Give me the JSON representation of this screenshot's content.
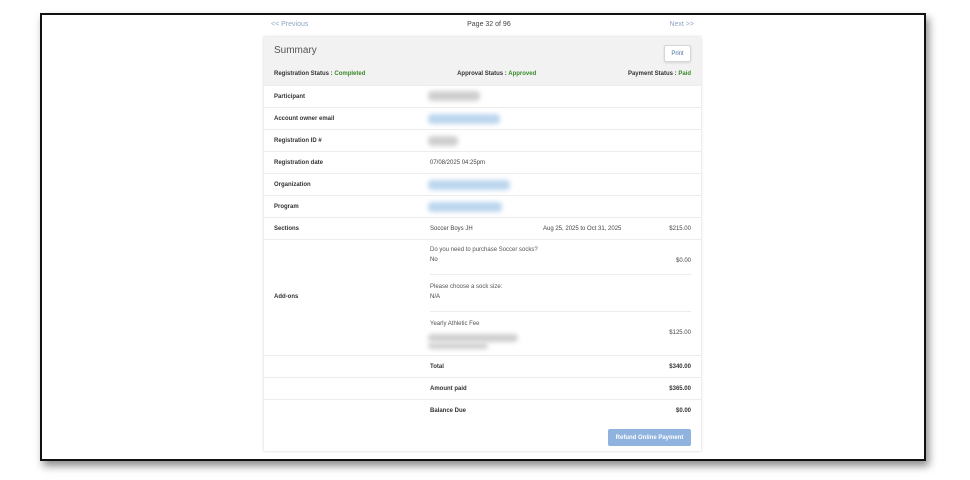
{
  "pager": {
    "previous": "<< Previous",
    "page": "Page 32 of 96",
    "next": "Next >>"
  },
  "summary": {
    "title": "Summary",
    "print": "Print",
    "registration_status_label": "Registration Status :",
    "registration_status": "Completed",
    "approval_status_label": "Approval Status :",
    "approval_status": "Approved",
    "payment_status_label": "Payment Status :",
    "payment_status": "Paid"
  },
  "rows": {
    "participant": "Participant",
    "account_email": "Account owner email",
    "registration_id": "Registration ID #",
    "registration_date": "Registration date",
    "registration_date_value": "07/08/2025 04:25pm",
    "organization": "Organization",
    "program": "Program",
    "sections": "Sections",
    "section_name": "Soccer Boys JH",
    "section_dates": "Aug 25, 2025 to Oct 31, 2025",
    "section_price": "$215.00",
    "addons": "Add-ons"
  },
  "addons": [
    {
      "question": "Do you need to purchase Soccer socks?",
      "answer": "No",
      "price": "$0.00"
    },
    {
      "question": "Please choose a sock size:",
      "answer": "N/A",
      "price": ""
    },
    {
      "question": "Yearly Athletic Fee",
      "answer": "",
      "price": "$125.00"
    }
  ],
  "totals": {
    "total_label": "Total",
    "total": "$340.00",
    "paid_label": "Amount paid",
    "paid": "$365.00",
    "balance_label": "Balance Due",
    "balance": "$0.00"
  },
  "refund_button": "Refund Online Payment",
  "colors": {
    "accent": "#8fb2de",
    "status_green": "#3a8a2a",
    "link": "#8fa6c4"
  }
}
